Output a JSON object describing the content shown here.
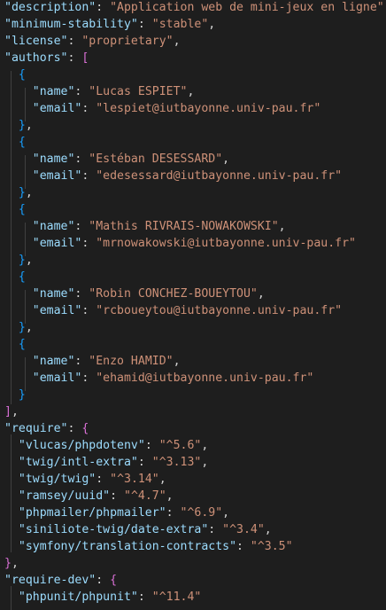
{
  "editor": {
    "language": "json",
    "theme": {
      "background": "#1e1e1e",
      "key_color": "#9cdcfe",
      "string_color": "#ce9178",
      "punctuation_color": "#d4d4d4",
      "bracket_colors": [
        "#ffd700",
        "#da70d6",
        "#179fff"
      ]
    },
    "lines": [
      [
        {
          "t": "\"description\"",
          "c": "k"
        },
        {
          "t": ": ",
          "c": "p"
        },
        {
          "t": "\"Application web de mini-jeux en ligne\"",
          "c": "s"
        },
        {
          "t": ",",
          "c": "p"
        }
      ],
      [
        {
          "t": "\"minimum-stability\"",
          "c": "k"
        },
        {
          "t": ": ",
          "c": "p"
        },
        {
          "t": "\"stable\"",
          "c": "s"
        },
        {
          "t": ",",
          "c": "p"
        }
      ],
      [
        {
          "t": "\"license\"",
          "c": "k"
        },
        {
          "t": ": ",
          "c": "p"
        },
        {
          "t": "\"proprietary\"",
          "c": "s"
        },
        {
          "t": ",",
          "c": "p"
        }
      ],
      [
        {
          "t": "\"authors\"",
          "c": "k"
        },
        {
          "t": ": ",
          "c": "p"
        },
        {
          "t": "[",
          "c": "b1"
        }
      ],
      [
        {
          "t": "  ",
          "c": "p"
        },
        {
          "t": "{",
          "c": "b2"
        }
      ],
      [
        {
          "t": "    ",
          "c": "p"
        },
        {
          "t": "\"name\"",
          "c": "k"
        },
        {
          "t": ": ",
          "c": "p"
        },
        {
          "t": "\"Lucas ESPIET\"",
          "c": "s"
        },
        {
          "t": ",",
          "c": "p"
        }
      ],
      [
        {
          "t": "    ",
          "c": "p"
        },
        {
          "t": "\"email\"",
          "c": "k"
        },
        {
          "t": ": ",
          "c": "p"
        },
        {
          "t": "\"lespiet@iutbayonne.univ-pau.fr\"",
          "c": "s"
        }
      ],
      [
        {
          "t": "  ",
          "c": "p"
        },
        {
          "t": "}",
          "c": "b2"
        },
        {
          "t": ",",
          "c": "p"
        }
      ],
      [
        {
          "t": "  ",
          "c": "p"
        },
        {
          "t": "{",
          "c": "b2"
        }
      ],
      [
        {
          "t": "    ",
          "c": "p"
        },
        {
          "t": "\"name\"",
          "c": "k"
        },
        {
          "t": ": ",
          "c": "p"
        },
        {
          "t": "\"Estéban DESESSARD\"",
          "c": "s"
        },
        {
          "t": ",",
          "c": "p"
        }
      ],
      [
        {
          "t": "    ",
          "c": "p"
        },
        {
          "t": "\"email\"",
          "c": "k"
        },
        {
          "t": ": ",
          "c": "p"
        },
        {
          "t": "\"edesessard@iutbayonne.univ-pau.fr\"",
          "c": "s"
        }
      ],
      [
        {
          "t": "  ",
          "c": "p"
        },
        {
          "t": "}",
          "c": "b2"
        },
        {
          "t": ",",
          "c": "p"
        }
      ],
      [
        {
          "t": "  ",
          "c": "p"
        },
        {
          "t": "{",
          "c": "b2"
        }
      ],
      [
        {
          "t": "    ",
          "c": "p"
        },
        {
          "t": "\"name\"",
          "c": "k"
        },
        {
          "t": ": ",
          "c": "p"
        },
        {
          "t": "\"Mathis RIVRAIS-NOWAKOWSKI\"",
          "c": "s"
        },
        {
          "t": ",",
          "c": "p"
        }
      ],
      [
        {
          "t": "    ",
          "c": "p"
        },
        {
          "t": "\"email\"",
          "c": "k"
        },
        {
          "t": ": ",
          "c": "p"
        },
        {
          "t": "\"mrnowakowski@iutbayonne.univ-pau.fr\"",
          "c": "s"
        }
      ],
      [
        {
          "t": "  ",
          "c": "p"
        },
        {
          "t": "}",
          "c": "b2"
        },
        {
          "t": ",",
          "c": "p"
        }
      ],
      [
        {
          "t": "  ",
          "c": "p"
        },
        {
          "t": "{",
          "c": "b2"
        }
      ],
      [
        {
          "t": "    ",
          "c": "p"
        },
        {
          "t": "\"name\"",
          "c": "k"
        },
        {
          "t": ": ",
          "c": "p"
        },
        {
          "t": "\"Robin CONCHEZ-BOUEYTOU\"",
          "c": "s"
        },
        {
          "t": ",",
          "c": "p"
        }
      ],
      [
        {
          "t": "    ",
          "c": "p"
        },
        {
          "t": "\"email\"",
          "c": "k"
        },
        {
          "t": ": ",
          "c": "p"
        },
        {
          "t": "\"rcboueytou@iutbayonne.univ-pau.fr\"",
          "c": "s"
        }
      ],
      [
        {
          "t": "  ",
          "c": "p"
        },
        {
          "t": "}",
          "c": "b2"
        },
        {
          "t": ",",
          "c": "p"
        }
      ],
      [
        {
          "t": "  ",
          "c": "p"
        },
        {
          "t": "{",
          "c": "b2"
        }
      ],
      [
        {
          "t": "    ",
          "c": "p"
        },
        {
          "t": "\"name\"",
          "c": "k"
        },
        {
          "t": ": ",
          "c": "p"
        },
        {
          "t": "\"Enzo HAMID\"",
          "c": "s"
        },
        {
          "t": ",",
          "c": "p"
        }
      ],
      [
        {
          "t": "    ",
          "c": "p"
        },
        {
          "t": "\"email\"",
          "c": "k"
        },
        {
          "t": ": ",
          "c": "p"
        },
        {
          "t": "\"ehamid@iutbayonne.univ-pau.fr\"",
          "c": "s"
        }
      ],
      [
        {
          "t": "  ",
          "c": "p"
        },
        {
          "t": "}",
          "c": "b2"
        }
      ],
      [
        {
          "t": "]",
          "c": "b1"
        },
        {
          "t": ",",
          "c": "p"
        }
      ],
      [
        {
          "t": "\"require\"",
          "c": "k"
        },
        {
          "t": ": ",
          "c": "p"
        },
        {
          "t": "{",
          "c": "b1"
        }
      ],
      [
        {
          "t": "  ",
          "c": "p"
        },
        {
          "t": "\"vlucas/phpdotenv\"",
          "c": "k"
        },
        {
          "t": ": ",
          "c": "p"
        },
        {
          "t": "\"^5.6\"",
          "c": "s"
        },
        {
          "t": ",",
          "c": "p"
        }
      ],
      [
        {
          "t": "  ",
          "c": "p"
        },
        {
          "t": "\"twig/intl-extra\"",
          "c": "k"
        },
        {
          "t": ": ",
          "c": "p"
        },
        {
          "t": "\"^3.13\"",
          "c": "s"
        },
        {
          "t": ",",
          "c": "p"
        }
      ],
      [
        {
          "t": "  ",
          "c": "p"
        },
        {
          "t": "\"twig/twig\"",
          "c": "k"
        },
        {
          "t": ": ",
          "c": "p"
        },
        {
          "t": "\"^3.14\"",
          "c": "s"
        },
        {
          "t": ",",
          "c": "p"
        }
      ],
      [
        {
          "t": "  ",
          "c": "p"
        },
        {
          "t": "\"ramsey/uuid\"",
          "c": "k"
        },
        {
          "t": ": ",
          "c": "p"
        },
        {
          "t": "\"^4.7\"",
          "c": "s"
        },
        {
          "t": ",",
          "c": "p"
        }
      ],
      [
        {
          "t": "  ",
          "c": "p"
        },
        {
          "t": "\"phpmailer/phpmailer\"",
          "c": "k"
        },
        {
          "t": ": ",
          "c": "p"
        },
        {
          "t": "\"^6.9\"",
          "c": "s"
        },
        {
          "t": ",",
          "c": "p"
        }
      ],
      [
        {
          "t": "  ",
          "c": "p"
        },
        {
          "t": "\"siniliote-twig/date-extra\"",
          "c": "k"
        },
        {
          "t": ": ",
          "c": "p"
        },
        {
          "t": "\"^3.4\"",
          "c": "s"
        },
        {
          "t": ",",
          "c": "p"
        }
      ],
      [
        {
          "t": "  ",
          "c": "p"
        },
        {
          "t": "\"symfony/translation-contracts\"",
          "c": "k"
        },
        {
          "t": ": ",
          "c": "p"
        },
        {
          "t": "\"^3.5\"",
          "c": "s"
        }
      ],
      [
        {
          "t": "}",
          "c": "b1"
        },
        {
          "t": ",",
          "c": "p"
        }
      ],
      [
        {
          "t": "\"require-dev\"",
          "c": "k"
        },
        {
          "t": ": ",
          "c": "p"
        },
        {
          "t": "{",
          "c": "b1"
        }
      ],
      [
        {
          "t": "  ",
          "c": "p"
        },
        {
          "t": "\"phpunit/phpunit\"",
          "c": "k"
        },
        {
          "t": ": ",
          "c": "p"
        },
        {
          "t": "\"^11.4\"",
          "c": "s"
        }
      ]
    ]
  }
}
